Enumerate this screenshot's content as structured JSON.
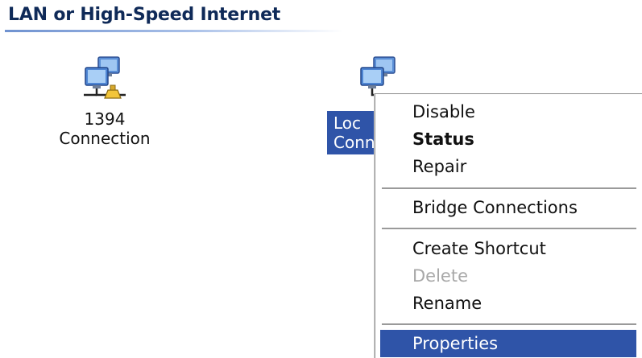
{
  "group": {
    "header": "LAN or High-Speed Internet"
  },
  "connections": [
    {
      "name": "1394 Connection",
      "line1": "1394",
      "line2": "Connection",
      "icon": "network-connection-icon"
    },
    {
      "name": "Local Area Connection",
      "line1": "Loc",
      "line2": "Conn",
      "icon": "network-connection-icon",
      "selected": true
    }
  ],
  "context_menu": {
    "items": [
      {
        "label": "Disable"
      },
      {
        "label": "Status",
        "default": true
      },
      {
        "label": "Repair"
      },
      {
        "label": "Bridge Connections"
      },
      {
        "label": "Create Shortcut"
      },
      {
        "label": "Delete",
        "disabled": true
      },
      {
        "label": "Rename"
      },
      {
        "label": "Properties",
        "highlighted": true
      }
    ]
  },
  "colors": {
    "selection": "#2f54a8",
    "header_text": "#0f2a58",
    "header_rule": "#6f92d0",
    "disabled_text": "#a8a8a8"
  }
}
